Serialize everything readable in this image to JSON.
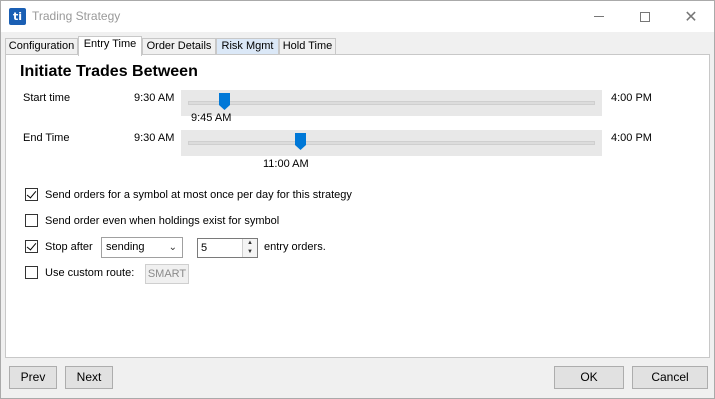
{
  "window": {
    "title": "Trading Strategy",
    "app_icon_text": "ti",
    "minimize_icon": "minimize-icon",
    "maximize_icon": "maximize-icon",
    "close_icon": "close-icon",
    "close_glyph": "✕"
  },
  "tabs": [
    {
      "label": "Configuration",
      "active": false
    },
    {
      "label": "Entry Time",
      "active": true
    },
    {
      "label": "Order Details",
      "active": false
    },
    {
      "label": "Risk Mgmt",
      "active": false
    },
    {
      "label": "Hold Time",
      "active": false
    }
  ],
  "entry_time": {
    "heading": "Initiate Trades Between",
    "start": {
      "label": "Start time",
      "min": "9:30 AM",
      "max": "4:00 PM",
      "value": "9:45 AM",
      "fraction": 0.0385
    },
    "end": {
      "label": "End Time",
      "min": "9:30 AM",
      "max": "4:00 PM",
      "value": "11:00 AM",
      "fraction": 0.2308
    },
    "options": {
      "once_per_day": {
        "label": "Send orders for a symbol at most once per day for this strategy",
        "checked": true
      },
      "send_even_holdings": {
        "label": "Send order even when holdings exist for symbol",
        "checked": false
      },
      "stop_after": {
        "label": "Stop after",
        "checked": true,
        "mode": "sending",
        "count": "5",
        "suffix": "entry orders."
      },
      "custom_route": {
        "label": "Use custom route:",
        "checked": false,
        "route": "SMART"
      }
    }
  },
  "footer": {
    "prev": "Prev",
    "next": "Next",
    "ok": "OK",
    "cancel": "Cancel"
  },
  "colors": {
    "thumb": "#0078d7",
    "panel": "#ffffff",
    "chrome": "#f0f0f0"
  }
}
